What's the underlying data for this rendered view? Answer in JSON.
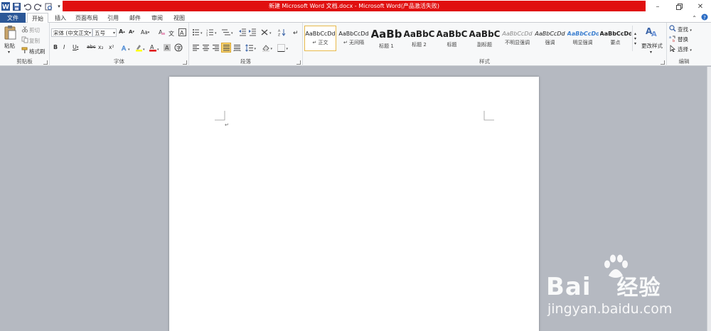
{
  "window": {
    "title": "新建 Microsoft Word 文档.docx - Microsoft Word(产品激活失败)",
    "title_bar_color": "#e01010"
  },
  "qat": {
    "icons": [
      "word-logo-icon",
      "save-icon",
      "undo-icon",
      "redo-icon",
      "print-preview-icon",
      "customize-qat-icon"
    ]
  },
  "tabs": [
    {
      "label": "文件"
    },
    {
      "label": "开始"
    },
    {
      "label": "插入"
    },
    {
      "label": "页面布局"
    },
    {
      "label": "引用"
    },
    {
      "label": "邮件"
    },
    {
      "label": "审阅"
    },
    {
      "label": "视图"
    }
  ],
  "ribbon": {
    "clipboard": {
      "label": "剪贴板",
      "paste": "粘贴",
      "cut": "剪切",
      "copy": "复制",
      "format_painter": "格式刷"
    },
    "font": {
      "label": "字体",
      "font_name": "宋体 (中文正文",
      "font_size": "五号",
      "bold": "B",
      "italic": "I",
      "underline": "U",
      "strikethrough": "abc",
      "subscript": "x₂",
      "superscript": "x²",
      "grow": "A",
      "shrink": "A",
      "change_case": "Aa",
      "font_color_swatch": "#e00000",
      "highlight_swatch": "#ffff00"
    },
    "paragraph": {
      "label": "段落"
    },
    "styles": {
      "label": "样式",
      "items": [
        {
          "sample": "AaBbCcDd",
          "name": "正文"
        },
        {
          "sample": "AaBbCcDd",
          "name": "无间隔"
        },
        {
          "sample": "AaBb",
          "name": "标题 1"
        },
        {
          "sample": "AaBbC",
          "name": "标题 2"
        },
        {
          "sample": "AaBbC",
          "name": "标题"
        },
        {
          "sample": "AaBbC",
          "name": "副标题"
        },
        {
          "sample": "AaBbCcDd",
          "name": "不明显强调"
        },
        {
          "sample": "AaBbCcDd",
          "name": "强调"
        },
        {
          "sample": "AaBbCcDd",
          "name": "明显强调"
        },
        {
          "sample": "AaBbCcDd",
          "name": "要点"
        }
      ],
      "change_styles": "更改样式"
    },
    "editing": {
      "label": "编辑",
      "find": "查找",
      "replace": "替换",
      "select": "选择"
    }
  },
  "watermark": {
    "brand": "Bai",
    "brand2": "经验",
    "url": "jingyan.baidu.com"
  }
}
